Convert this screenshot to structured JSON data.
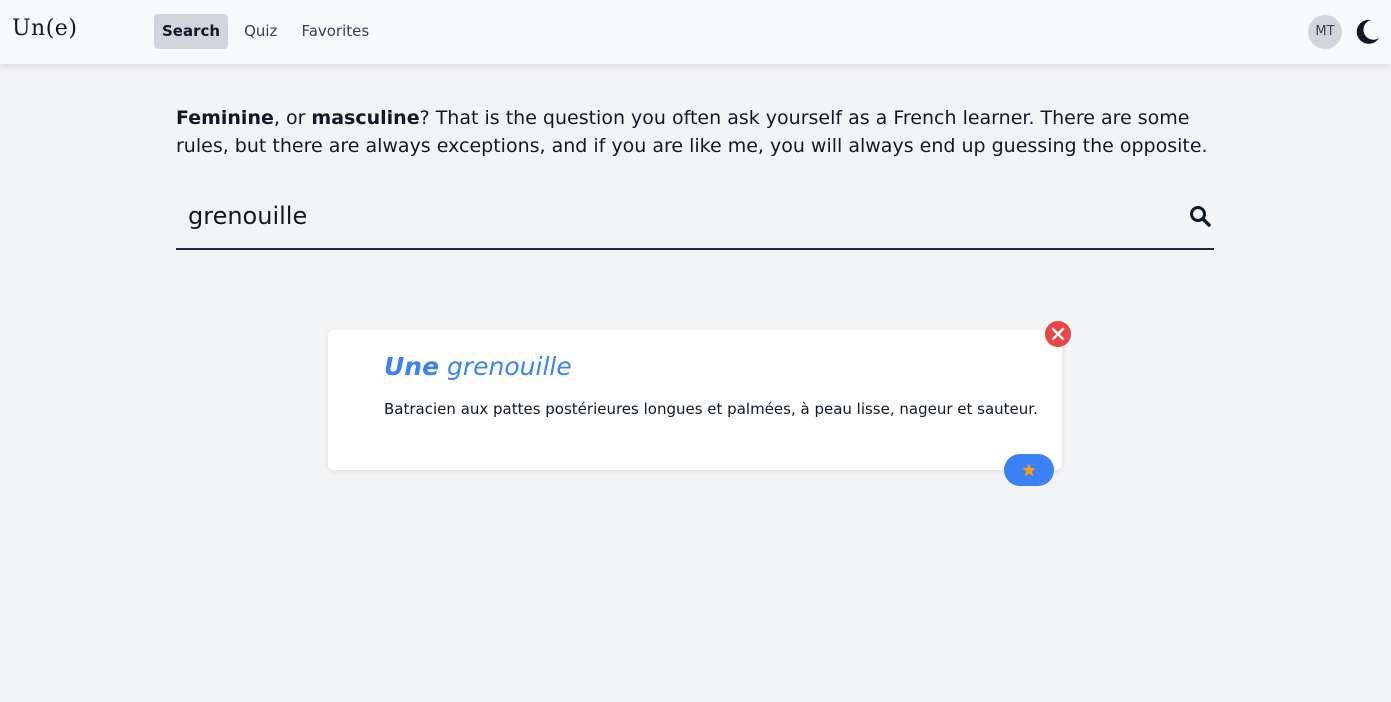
{
  "app": {
    "logo": "Un(e)"
  },
  "nav": {
    "items": [
      {
        "label": "Search",
        "active": true
      },
      {
        "label": "Quiz",
        "active": false
      },
      {
        "label": "Favorites",
        "active": false
      }
    ]
  },
  "user": {
    "initials": "MT"
  },
  "intro": {
    "bold1": "Feminine",
    "text1": ", or ",
    "bold2": "masculine",
    "text2": "? That is the question you often ask yourself as a French learner. There are some rules, but there are always exceptions, and if you are like me, you will always end up guessing the opposite."
  },
  "search": {
    "value": "grenouille"
  },
  "result": {
    "article": "Une",
    "word": "grenouille",
    "definition": "Batracien aux pattes postérieures longues et palmées, à peau lisse, nageur et sauteur."
  },
  "colors": {
    "accent": "#3b82f6",
    "danger": "#ef4444",
    "star": "#f59e0b"
  },
  "icons": {
    "theme": "moon-icon",
    "search": "search-icon",
    "close": "close-icon",
    "favorite": "star-icon"
  }
}
